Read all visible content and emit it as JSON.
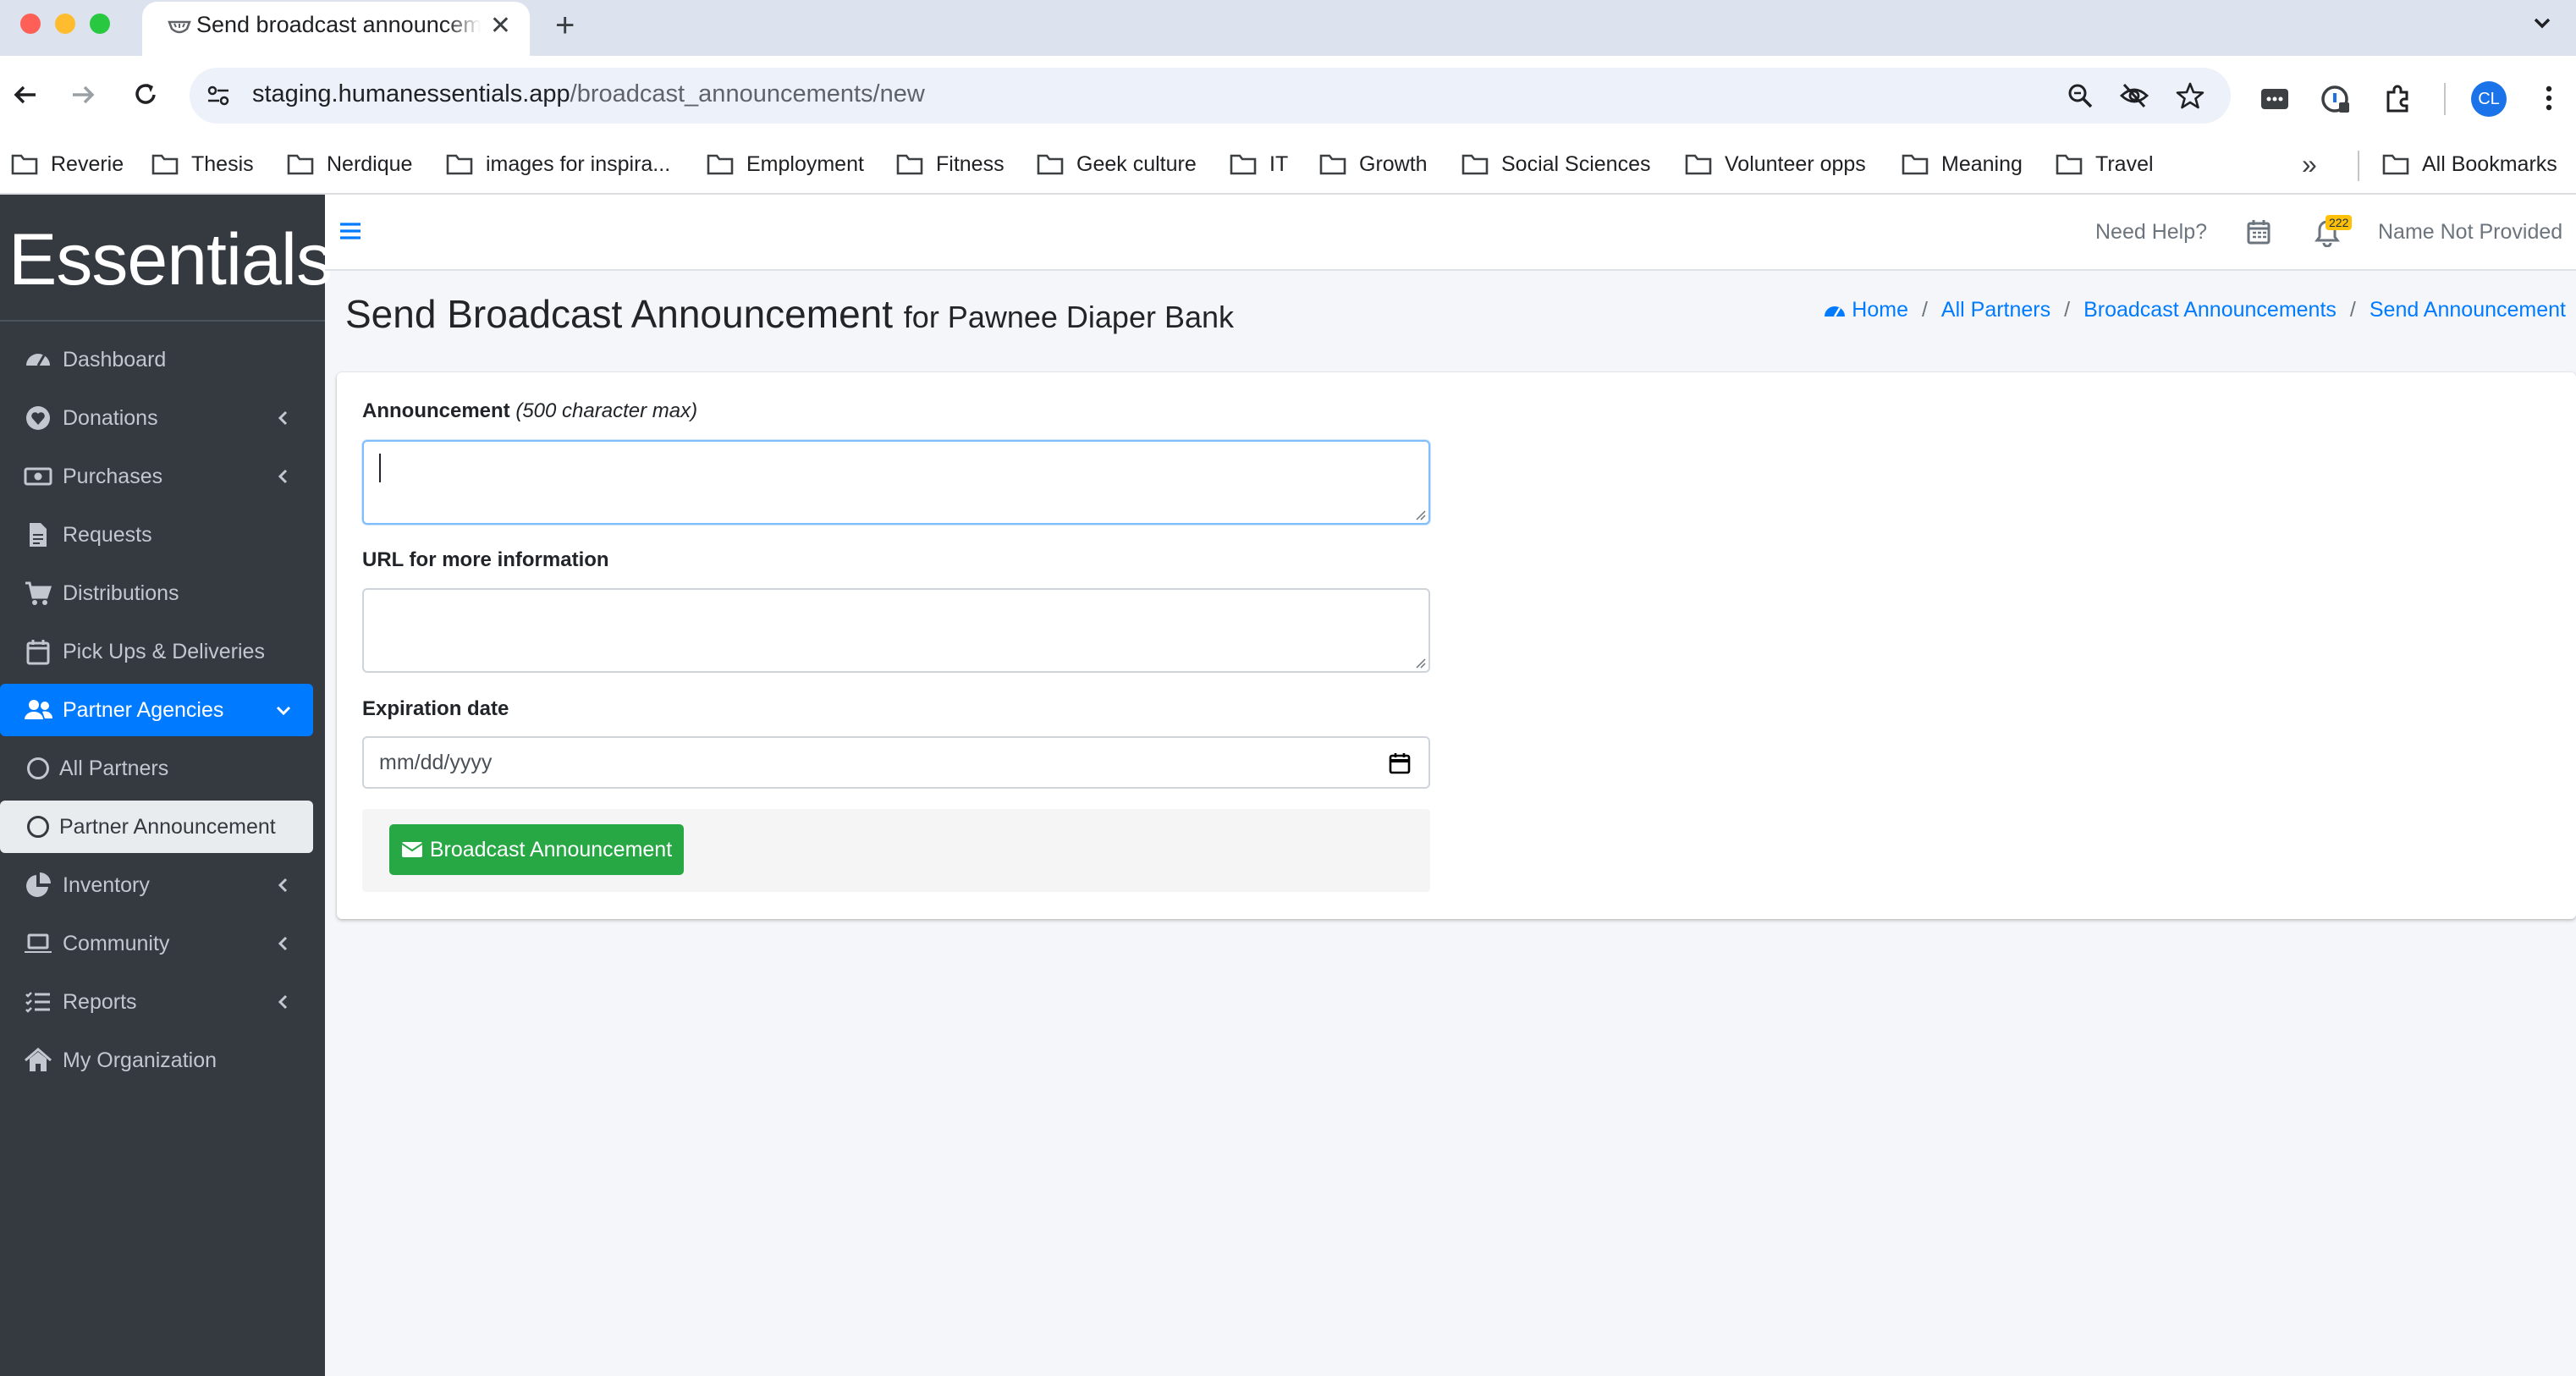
{
  "browser": {
    "tab_title": "Send broadcast announcement",
    "url_host": "staging.humanessentials.app",
    "url_path": "/broadcast_announcements/new",
    "profile_initials": "CL",
    "bookmarks": [
      "Reverie",
      "Thesis",
      "Nerdique",
      "images for inspira...",
      "Employment",
      "Fitness",
      "Geek culture",
      "IT",
      "Growth",
      "Social Sciences",
      "Volunteer opps",
      "Meaning",
      "Travel"
    ],
    "all_bookmarks": "All Bookmarks"
  },
  "sidebar": {
    "brand": "Essentials",
    "items": [
      {
        "label": "Dashboard",
        "icon": "dashboard-icon"
      },
      {
        "label": "Donations",
        "icon": "heart-icon"
      },
      {
        "label": "Purchases",
        "icon": "money-bill-icon"
      },
      {
        "label": "Requests",
        "icon": "file-icon"
      },
      {
        "label": "Distributions",
        "icon": "cart-icon"
      },
      {
        "label": "Pick Ups & Deliveries",
        "icon": "calendar-icon"
      },
      {
        "label": "Partner Agencies",
        "icon": "users-icon"
      },
      {
        "label": "All Partners",
        "icon": "circle-icon"
      },
      {
        "label": "Partner Announcement",
        "icon": "circle-icon"
      },
      {
        "label": "Inventory",
        "icon": "pie-chart-icon"
      },
      {
        "label": "Community",
        "icon": "laptop-icon"
      },
      {
        "label": "Reports",
        "icon": "list-icon"
      },
      {
        "label": "My Organization",
        "icon": "home-icon"
      }
    ]
  },
  "topbar": {
    "help": "Need Help?",
    "notification_count": "222",
    "user_name": "Name Not Provided"
  },
  "page": {
    "title": "Send Broadcast Announcement",
    "subtitle": "for Pawnee Diaper Bank",
    "breadcrumb": [
      "Home",
      "All Partners",
      "Broadcast Announcements",
      "Send Announcement"
    ]
  },
  "form": {
    "announcement_label": "Announcement",
    "announcement_hint": "(500 character max)",
    "announcement_value": "",
    "url_label": "URL for more information",
    "url_value": "",
    "expiration_label": "Expiration date",
    "expiration_placeholder": "mm/dd/yyyy",
    "submit_label": "Broadcast Announcement"
  },
  "colors": {
    "sidebar_bg": "#343a40",
    "accent": "#007bff",
    "submit": "#28a745"
  }
}
